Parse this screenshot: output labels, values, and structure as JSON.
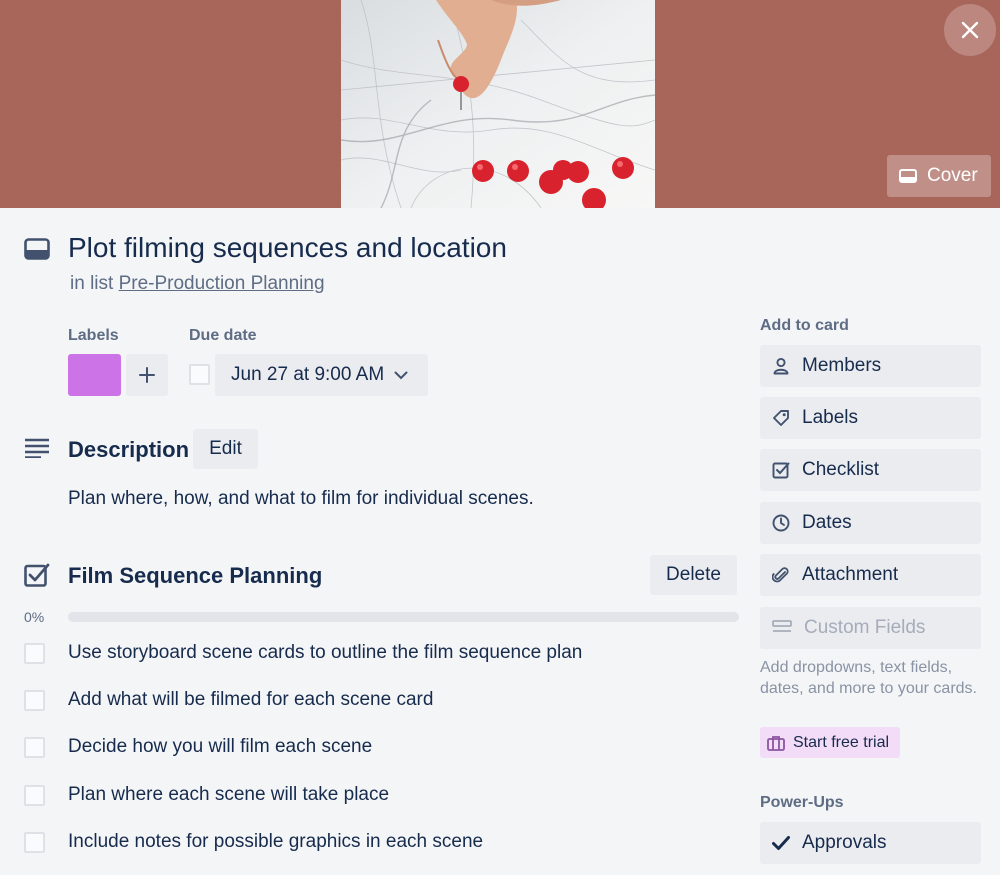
{
  "cover": {
    "button_label": "Cover",
    "background_color": "#a8665b"
  },
  "card": {
    "title": "Plot filming sequences and location",
    "in_list_prefix": "in list",
    "list_name": "Pre-Production Planning"
  },
  "labels": {
    "heading": "Labels",
    "items": [
      {
        "color": "#cd73e8"
      }
    ]
  },
  "due_date": {
    "heading": "Due date",
    "value": "Jun 27 at 9:00 AM",
    "completed": false
  },
  "description": {
    "heading": "Description",
    "edit_label": "Edit",
    "text": "Plan where, how, and what to film for individual scenes."
  },
  "checklist": {
    "title": "Film Sequence Planning",
    "delete_label": "Delete",
    "progress_label": "0%",
    "progress": 0,
    "items": [
      {
        "text": "Use storyboard scene cards to outline the film sequence plan",
        "checked": false
      },
      {
        "text": "Add what will be filmed for each scene card",
        "checked": false
      },
      {
        "text": "Decide how you will film each scene",
        "checked": false
      },
      {
        "text": "Plan where each scene will take place",
        "checked": false
      },
      {
        "text": "Include notes for possible graphics in each scene",
        "checked": false
      }
    ]
  },
  "sidebar": {
    "add_to_card_heading": "Add to card",
    "buttons": [
      {
        "label": "Members",
        "icon": "person-icon"
      },
      {
        "label": "Labels",
        "icon": "tag-icon"
      },
      {
        "label": "Checklist",
        "icon": "checklist-icon"
      },
      {
        "label": "Dates",
        "icon": "clock-icon"
      },
      {
        "label": "Attachment",
        "icon": "paperclip-icon"
      },
      {
        "label": "Custom Fields",
        "icon": "custom-fields-icon"
      }
    ],
    "custom_fields_note": "Add dropdowns, text fields, dates, and more to your cards.",
    "trial_label": "Start free trial",
    "power_ups_heading": "Power-Ups",
    "approvals_label": "Approvals"
  }
}
